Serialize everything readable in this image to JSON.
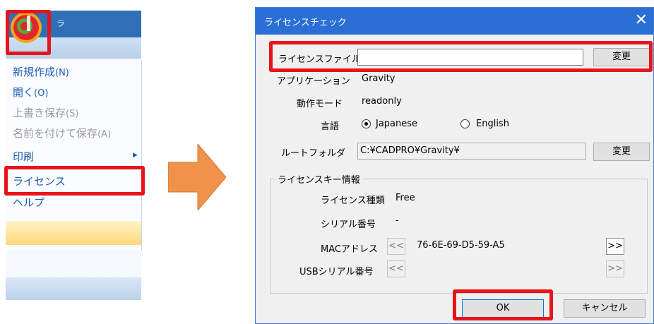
{
  "menu": {
    "title_fragment": "ラ",
    "items": [
      {
        "label": "新規作成",
        "mnemonic": "(N)"
      },
      {
        "label": "開く",
        "mnemonic": "(O)"
      },
      {
        "label": "上書き保存",
        "mnemonic": "(S)"
      },
      {
        "label": "名前を付けて保存",
        "mnemonic": "(A)"
      },
      {
        "label": "印刷",
        "mnemonic": ""
      },
      {
        "label": "ライセンス",
        "mnemonic": ""
      },
      {
        "label": "ヘルプ",
        "mnemonic": ""
      }
    ],
    "submenu_indicator": "▶",
    "colors": {
      "title_bar": "#2f6fb8",
      "highlight": "#ffd77c",
      "annotation": "#e8141b"
    }
  },
  "arrow": {
    "icon": "right-arrow-icon",
    "color": "#f0924a"
  },
  "dialog": {
    "title": "ライセンスチェック",
    "close_glyph": "✕",
    "license_file": {
      "label": "ライセンスファイル",
      "value": "",
      "button": "変更"
    },
    "application": {
      "label": "アプリケーション",
      "value": "Gravity"
    },
    "mode": {
      "label": "動作モード",
      "value": "readonly"
    },
    "language": {
      "label": "言語",
      "options": [
        "Japanese",
        "English"
      ],
      "selected": "Japanese"
    },
    "root_folder": {
      "label": "ルートフォルダ",
      "value": "C:¥CADPRO¥Gravity¥",
      "button": "変更"
    },
    "license_key": {
      "group_title": "ライセンスキー情報",
      "type": {
        "label": "ライセンス種類",
        "value": "Free"
      },
      "serial": {
        "label": "シリアル番号",
        "value": "-"
      },
      "mac": {
        "label": "MACアドレス",
        "value": "76-6E-69-D5-59-A5",
        "prev": "<<",
        "next": ">>"
      },
      "usb": {
        "label": "USBシリアル番号",
        "value": "",
        "prev": "<<",
        "next": ">>"
      }
    },
    "ok_button": "OK",
    "cancel_button": "キャンセル",
    "colors": {
      "title_bar": "#2b6fd6",
      "annotation": "#e8141b"
    }
  }
}
